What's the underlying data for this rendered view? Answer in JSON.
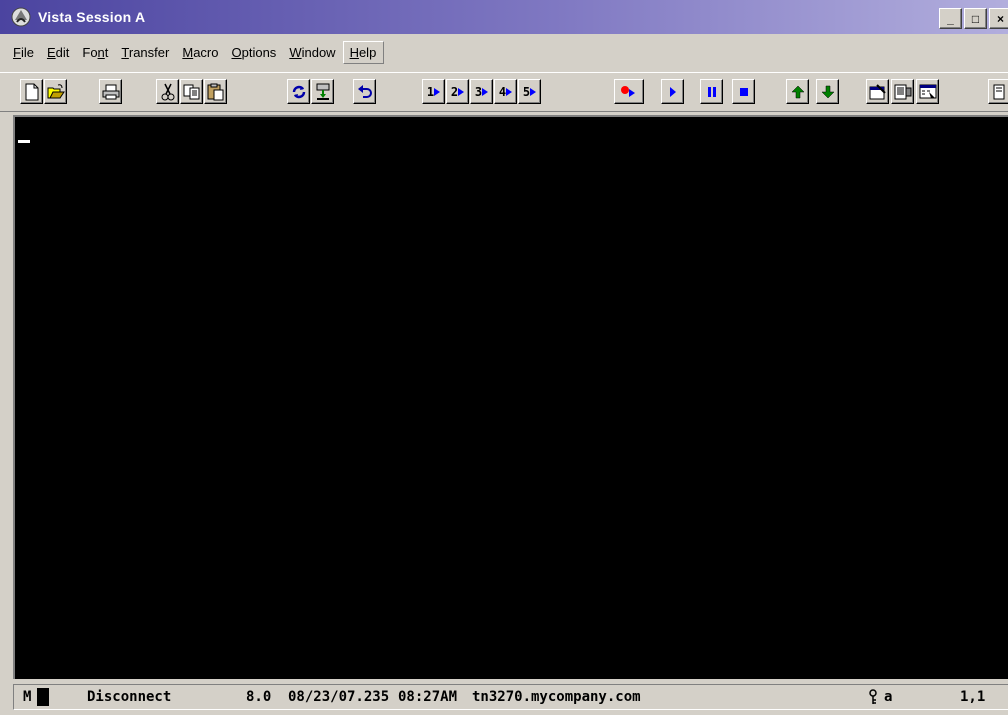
{
  "window": {
    "title": "Vista Session A",
    "controls": {
      "minimize": "_",
      "maximize": "□",
      "close": "×"
    }
  },
  "menu": {
    "items": [
      {
        "pre": "",
        "key": "F",
        "post": "ile"
      },
      {
        "pre": "",
        "key": "E",
        "post": "dit"
      },
      {
        "pre": "Fo",
        "key": "n",
        "post": "t"
      },
      {
        "pre": "",
        "key": "T",
        "post": "ransfer"
      },
      {
        "pre": "",
        "key": "M",
        "post": "acro"
      },
      {
        "pre": "",
        "key": "O",
        "post": "ptions"
      },
      {
        "pre": "",
        "key": "W",
        "post": "indow"
      },
      {
        "pre": "",
        "key": "H",
        "post": "elp"
      }
    ]
  },
  "toolbar": {
    "macro_numbers": [
      "1",
      "2",
      "3",
      "4",
      "5"
    ],
    "icons": [
      "new-document-icon",
      "open-folder-icon",
      "print-icon",
      "cut-icon",
      "copy-icon",
      "paste-icon",
      "connect-icon",
      "disconnect-icon",
      "undo-icon",
      "macro-1-icon",
      "macro-2-icon",
      "macro-3-icon",
      "macro-4-icon",
      "macro-5-icon",
      "record-icon",
      "play-icon",
      "pause-icon",
      "stop-icon",
      "up-arrow-icon",
      "down-arrow-icon",
      "properties-icon",
      "session-icon",
      "keyboard-map-icon",
      "extra-icon"
    ]
  },
  "terminal": {
    "background": "#000000",
    "cursor_color": "#ffffff"
  },
  "status": {
    "mode": "M",
    "connection": "Disconnect",
    "version": "8.0",
    "date": "08/23/07.235",
    "time": "08:27AM",
    "host": "tn3270.mycompany.com",
    "indicator": "a",
    "position": "1,1"
  },
  "colors": {
    "title_start": "#4b44a0",
    "title_end": "#b2aedd",
    "face": "#d4d0c8",
    "green": "#008000",
    "blue": "#0000ff",
    "red": "#ff0000"
  }
}
